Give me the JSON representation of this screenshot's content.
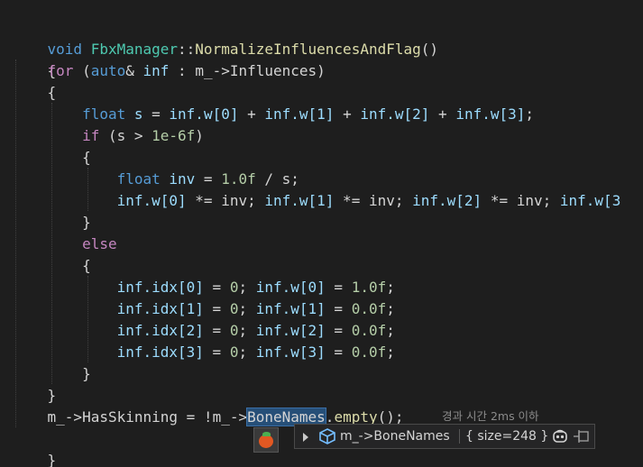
{
  "code": {
    "l1": {
      "void": "void ",
      "cls": "FbxManager",
      "sep": "::",
      "fn": "NormalizeInfluencesAndFlag",
      "rest": "()"
    },
    "l2": "{",
    "l3": {
      "for": "for",
      "p1": " (",
      "auto": "auto",
      "amp": "& ",
      "inf": "inf",
      "colon": " : ",
      "m": "m_",
      "arrow": "->",
      "inf2": "Influences",
      "close": ")"
    },
    "l4": "{",
    "l5": {
      "float": "float",
      "s": " s",
      "eq": " = ",
      "w0": "inf.w[0]",
      "p1": " + ",
      "w1": "inf.w[1]",
      "p2": " + ",
      "w2": "inf.w[2]",
      "p3": " + ",
      "w3": "inf.w[3]",
      "semi": ";"
    },
    "l6": {
      "if": "if",
      "p": " (s > ",
      "num": "1e-6f",
      "close": ")"
    },
    "l7": "{",
    "l8": {
      "float": "float",
      "inv": " inv",
      "eq": " = ",
      "num": "1.0f",
      "rest": " / s;"
    },
    "l9": {
      "a": "inf.w[0]",
      "b": " *= inv; ",
      "c": "inf.w[1]",
      "d": " *= inv; ",
      "e": "inf.w[2]",
      "f": " *= inv; ",
      "g": "inf.w[3"
    },
    "l10": "}",
    "l11": "else",
    "l12": "{",
    "l13": {
      "a": "inf.idx[0]",
      "b": " = ",
      "n1": "0",
      "c": "; ",
      "d": "inf.w[0]",
      "e": " = ",
      "n2": "1.0f",
      "f": ";"
    },
    "l14": {
      "a": "inf.idx[1]",
      "b": " = ",
      "n1": "0",
      "c": "; ",
      "d": "inf.w[1]",
      "e": " = ",
      "n2": "0.0f",
      "f": ";"
    },
    "l15": {
      "a": "inf.idx[2]",
      "b": " = ",
      "n1": "0",
      "c": "; ",
      "d": "inf.w[2]",
      "e": " = ",
      "n2": "0.0f",
      "f": ";"
    },
    "l16": {
      "a": "inf.idx[3]",
      "b": " = ",
      "n1": "0",
      "c": "; ",
      "d": "inf.w[3]",
      "e": " = ",
      "n2": "0.0f",
      "f": ";"
    },
    "l17": "}",
    "l18": "}",
    "l19": {
      "m": "m_",
      "arrow": "->",
      "has": "HasSkinning",
      "eq": " = !",
      "m2": "m_",
      "arrow2": "->",
      "bones": "BoneNames",
      "dot": ".",
      "empty": "empty",
      "rest": "();"
    },
    "l20": "}"
  },
  "hint": {
    "text": "경과 시간 2ms 이하"
  },
  "datatip": {
    "name": "m_->BoneNames",
    "value": "{ size=248 }",
    "cube_icon": "variable-cube-icon",
    "copilot_icon": "copilot-icon",
    "pin_icon": "pin-icon",
    "expand_icon": "expand-arrow-icon"
  },
  "tomato_icon": "tomato-icon",
  "colors": {
    "background": "#1e1e1e",
    "keyword": "#569cd6",
    "control": "#c586c0",
    "function": "#dcdcaa",
    "type": "#4ec9b0",
    "variable": "#9cdcfe",
    "number": "#b5cea8",
    "selection": "#264f78"
  }
}
